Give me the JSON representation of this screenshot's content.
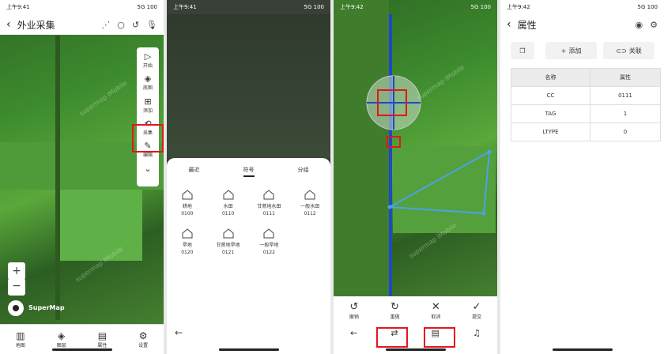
{
  "screen1": {
    "status_time": "上午9:41",
    "status_right": "5G 100",
    "title": "外业采集",
    "toolbar": [
      {
        "icon": "play-icon",
        "label": "开始"
      },
      {
        "icon": "layers-icon",
        "label": "底图"
      },
      {
        "icon": "add-icon",
        "label": "添加"
      },
      {
        "icon": "collect-icon",
        "label": "采集"
      },
      {
        "icon": "edit-icon",
        "label": "编辑"
      }
    ],
    "brand": "SuperMap",
    "watermark": "supermap iMobile",
    "tabs": [
      {
        "icon": "map-icon",
        "label": "地图"
      },
      {
        "icon": "layers-icon",
        "label": "图层"
      },
      {
        "icon": "attribute-icon",
        "label": "属性"
      },
      {
        "icon": "gear-icon",
        "label": "设置"
      }
    ]
  },
  "screen2": {
    "status_time": "上午9:41",
    "tabs": [
      "最近",
      "符号",
      "分组"
    ],
    "active_tab": "符号",
    "symbols": [
      {
        "name": "耕地",
        "code": "0100"
      },
      {
        "name": "水田",
        "code": "0110"
      },
      {
        "name": "甘蔗地水田",
        "code": "0111"
      },
      {
        "name": "一般水田",
        "code": "0112"
      },
      {
        "name": "旱地",
        "code": "0120"
      },
      {
        "name": "甘蔗地旱地",
        "code": "0121"
      },
      {
        "name": "一般旱地",
        "code": "0122"
      }
    ]
  },
  "screen3": {
    "status_time": "上午9:42",
    "watermark": "supermap iMobile",
    "actions": [
      {
        "icon": "undo-icon",
        "label": "撤销"
      },
      {
        "icon": "redo-icon",
        "label": "重做"
      },
      {
        "icon": "cancel-icon",
        "label": "取消"
      },
      {
        "icon": "check-icon",
        "label": "提交"
      }
    ]
  },
  "screen4": {
    "status_time": "上午9:42",
    "title": "属性",
    "add_label": "添加",
    "link_label": "关联",
    "table_headers": [
      "名称",
      "属性"
    ],
    "rows": [
      [
        "CC",
        "0111"
      ],
      [
        "TAG",
        "1"
      ],
      [
        "LTYPE",
        "0"
      ]
    ]
  },
  "colors": {
    "highlight": "#e3161c",
    "polygon": "#4aa3e8",
    "map_green": "#3d8a2e"
  }
}
